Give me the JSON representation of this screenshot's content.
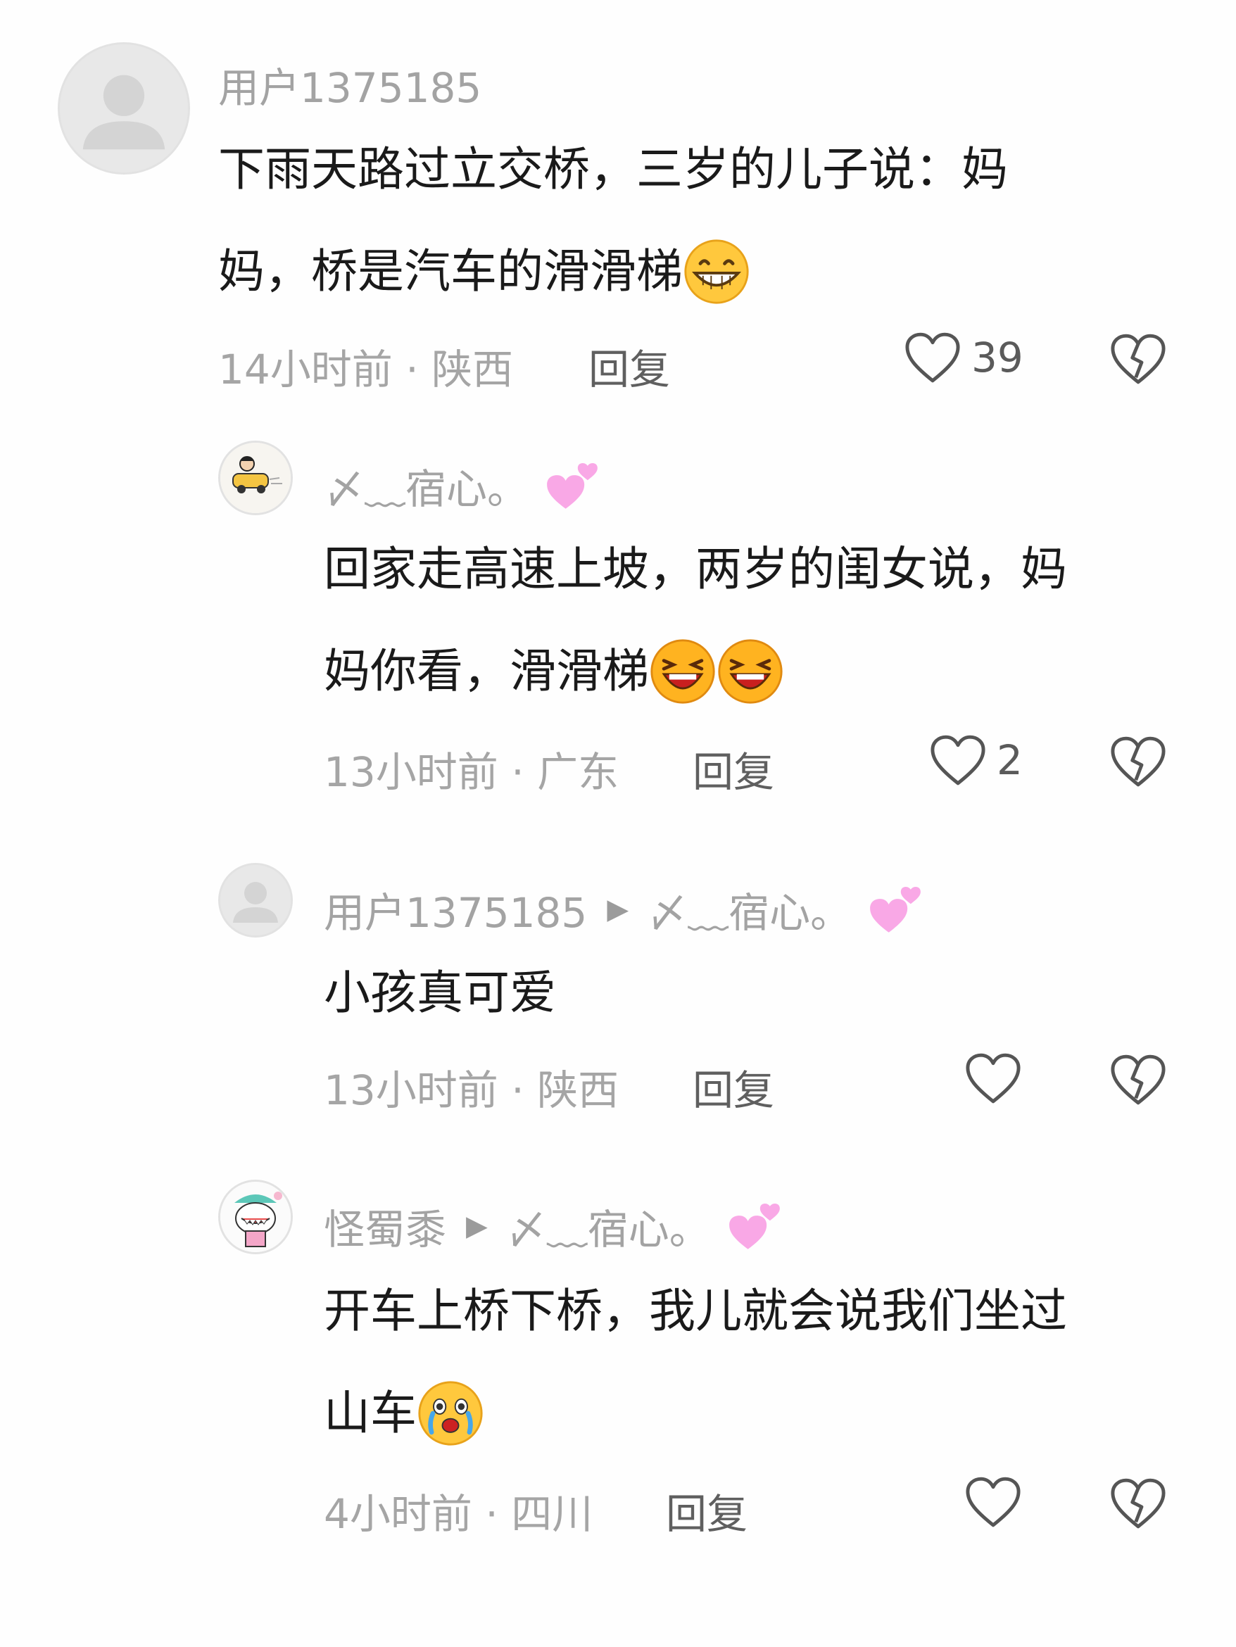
{
  "comments": [
    {
      "username": "用户1375185",
      "reply_to": "",
      "text_line1": "下雨天路过立交桥，三岁的儿子说：妈",
      "text_line2": "妈，桥是汽车的滑滑梯",
      "emoji": "grinning-face-icon",
      "time_location": "14小时前 · 陕西",
      "reply_label": "回复",
      "like_count": "39"
    },
    {
      "username": "〆﹏宿心。",
      "reply_to": "",
      "text_line1": "回家走高速上坡，两岁的闺女说，妈",
      "text_line2": "妈你看，滑滑梯",
      "emoji": "laughing-face-icon",
      "time_location": "13小时前 · 广东",
      "reply_label": "回复",
      "like_count": "2"
    },
    {
      "username": "用户1375185",
      "reply_to": "〆﹏宿心。",
      "text_line1": "小孩真可爱",
      "text_line2": "",
      "time_location": "13小时前 · 陕西",
      "reply_label": "回复",
      "like_count": ""
    },
    {
      "username": "怪蜀黍",
      "reply_to": "〆﹏宿心。",
      "text_line1": "开车上桥下桥，我儿就会说我们坐过",
      "text_line2": "山车",
      "emoji": "crying-face-icon",
      "time_location": "4小时前 · 四川",
      "reply_label": "回复",
      "like_count": ""
    }
  ],
  "reply_arrow": "▶",
  "colors": {
    "background": "#fefefe",
    "username": "#a3a3a3",
    "meta": "#a5a5a5",
    "text": "#1a1a1a",
    "heart_emoji": "#f9a8e6"
  }
}
